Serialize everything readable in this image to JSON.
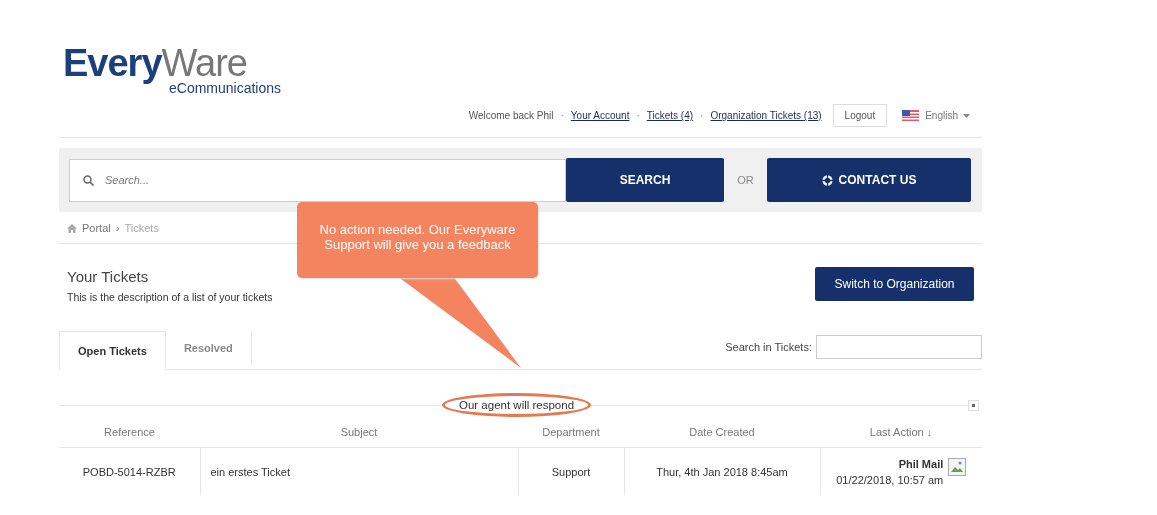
{
  "logo": {
    "word_1": "Every",
    "word_2": "Ware",
    "tagline": "eCommunications"
  },
  "header": {
    "welcome": "Welcome back Phil",
    "separator": "·",
    "links": [
      "Your Account",
      "Tickets (4)",
      "Organization Tickets (13)"
    ],
    "logout": "Logout",
    "language": "English"
  },
  "search": {
    "placeholder": "Search...",
    "button": "SEARCH",
    "or": "OR",
    "contact": "CONTACT US"
  },
  "breadcrumb": {
    "items": [
      "Portal",
      "Tickets"
    ],
    "separator": "›"
  },
  "page": {
    "title": "Your Tickets",
    "description": "This is the description of a list of your tickets",
    "switch_button": "Switch to Organization"
  },
  "tabs": [
    {
      "label": "Open Tickets",
      "selected": true
    },
    {
      "label": "Resolved",
      "selected": false
    }
  ],
  "ticket_search": {
    "label": "Search in Tickets:"
  },
  "callout": "No action needed. Our Everyware Support will give you a feedback",
  "group": "Our agent will respond",
  "table": {
    "columns": [
      "Reference",
      "Subject",
      "Department",
      "Date Created",
      "Last Action ↓"
    ],
    "rows": [
      {
        "reference": "POBD-5014-RZBR",
        "subject": "ein erstes Ticket",
        "department": "Support",
        "date_created": "Thur, 4th Jan 2018 8:45am",
        "last_action_by": "Phil Mail",
        "last_action_time": "01/22/2018, 10:57 am"
      }
    ]
  }
}
